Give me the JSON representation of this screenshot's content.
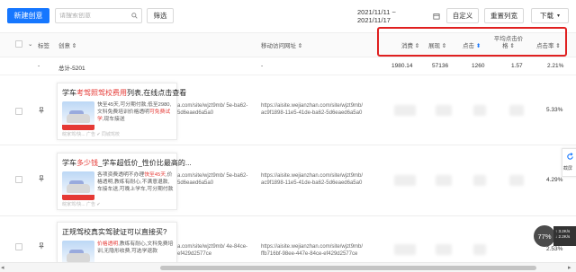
{
  "toolbar": {
    "new_button": "新建创意",
    "search_placeholder": "请搜索创意",
    "filter_button": "筛选",
    "date_range": "2021/11/11 ~ 2021/11/17",
    "custom_button": "自定义",
    "reset_button": "重置列宽",
    "download_button": "下载"
  },
  "table": {
    "headers": [
      "标签",
      "创意",
      "移动访问网址",
      "消费",
      "展现",
      "点击",
      "平均点击价格",
      "点击率"
    ],
    "summary": {
      "label": "总计-5201",
      "spend": "1980.14",
      "impressions": "57136",
      "clicks": "1260",
      "avg_cpc": "1.57",
      "ctr": "2.21%"
    },
    "rows": [
      {
        "title_plain_a": "学车",
        "title_red": "考驾照驾校费用",
        "title_plain_b": "列表,在线点击查看",
        "desc_a": "快至45天,可分期付款,低至2980,文科免费培训价格透明",
        "desc_red": "可免费试学",
        "desc_b": ",现车接送",
        "meta": "皖家驾/快...    广告 ✔ 同城驾校",
        "url1": "a.com/site/wjzt9mb/ 5e-ba62-5d6eaed6a5a0",
        "url2": "https://aisite.wejianzhan.com/site/wjzt9mb/ ac9f1898-11e5-41de-ba62-5d6eaed6a5a0",
        "ctr": "5.33%"
      },
      {
        "title_plain_a": "学车",
        "title_red": "多少钱",
        "title_plain_b": "_学车超低价_性价比最高的...",
        "desc_a": "各项资费透明不办理",
        "desc_red": "快至45天",
        "desc_b": ",价格透明,教练有耐心,不满意退款,车接车送,可晚上学车,可分期付款",
        "meta": "皖家驾/快...    广告 ✔",
        "url1": "a.com/site/wjzt9mb/ 5e-ba62-5d6eaed6a5a0",
        "url2": "https://aisite.wejianzhan.com/site/wjzt9mb/ ac9f1898-11e5-41de-ba62-5d6eaed6a5a0",
        "ctr": "4.29%"
      },
      {
        "title_plain_a": "正规驾校真实驾驶证",
        "title_red": "",
        "title_plain_b": "可以直接买?",
        "desc_a": "",
        "desc_red": "价格透明",
        "desc_b": ",教练有耐心,文科免费培训,无隐形收费,可选学退款",
        "meta": "",
        "url1": "a.com/site/wjzt9mb/ 4e-84ce-ef429d2577ce",
        "url2": "https://aisite.wejianzhan.com/site/wjzt9mb/ ffb716bf-98ee-447e-84ce-ef429d2577ce",
        "ctr": "2.53%"
      }
    ]
  },
  "side_widget": {
    "label": "截屏"
  },
  "overlay": {
    "badge": "77%",
    "speed_up": "↑ 3.2K/s",
    "speed_down": "↓ 2.2K/s"
  },
  "icons": [
    "search-icon",
    "calendar-icon",
    "chevron-down-icon",
    "pin-icon",
    "sort-icon",
    "filter-icon",
    "refresh-icon"
  ],
  "colors": {
    "primary": "#1677ff",
    "highlight_border": "#e02020",
    "red_text": "#e53935"
  }
}
